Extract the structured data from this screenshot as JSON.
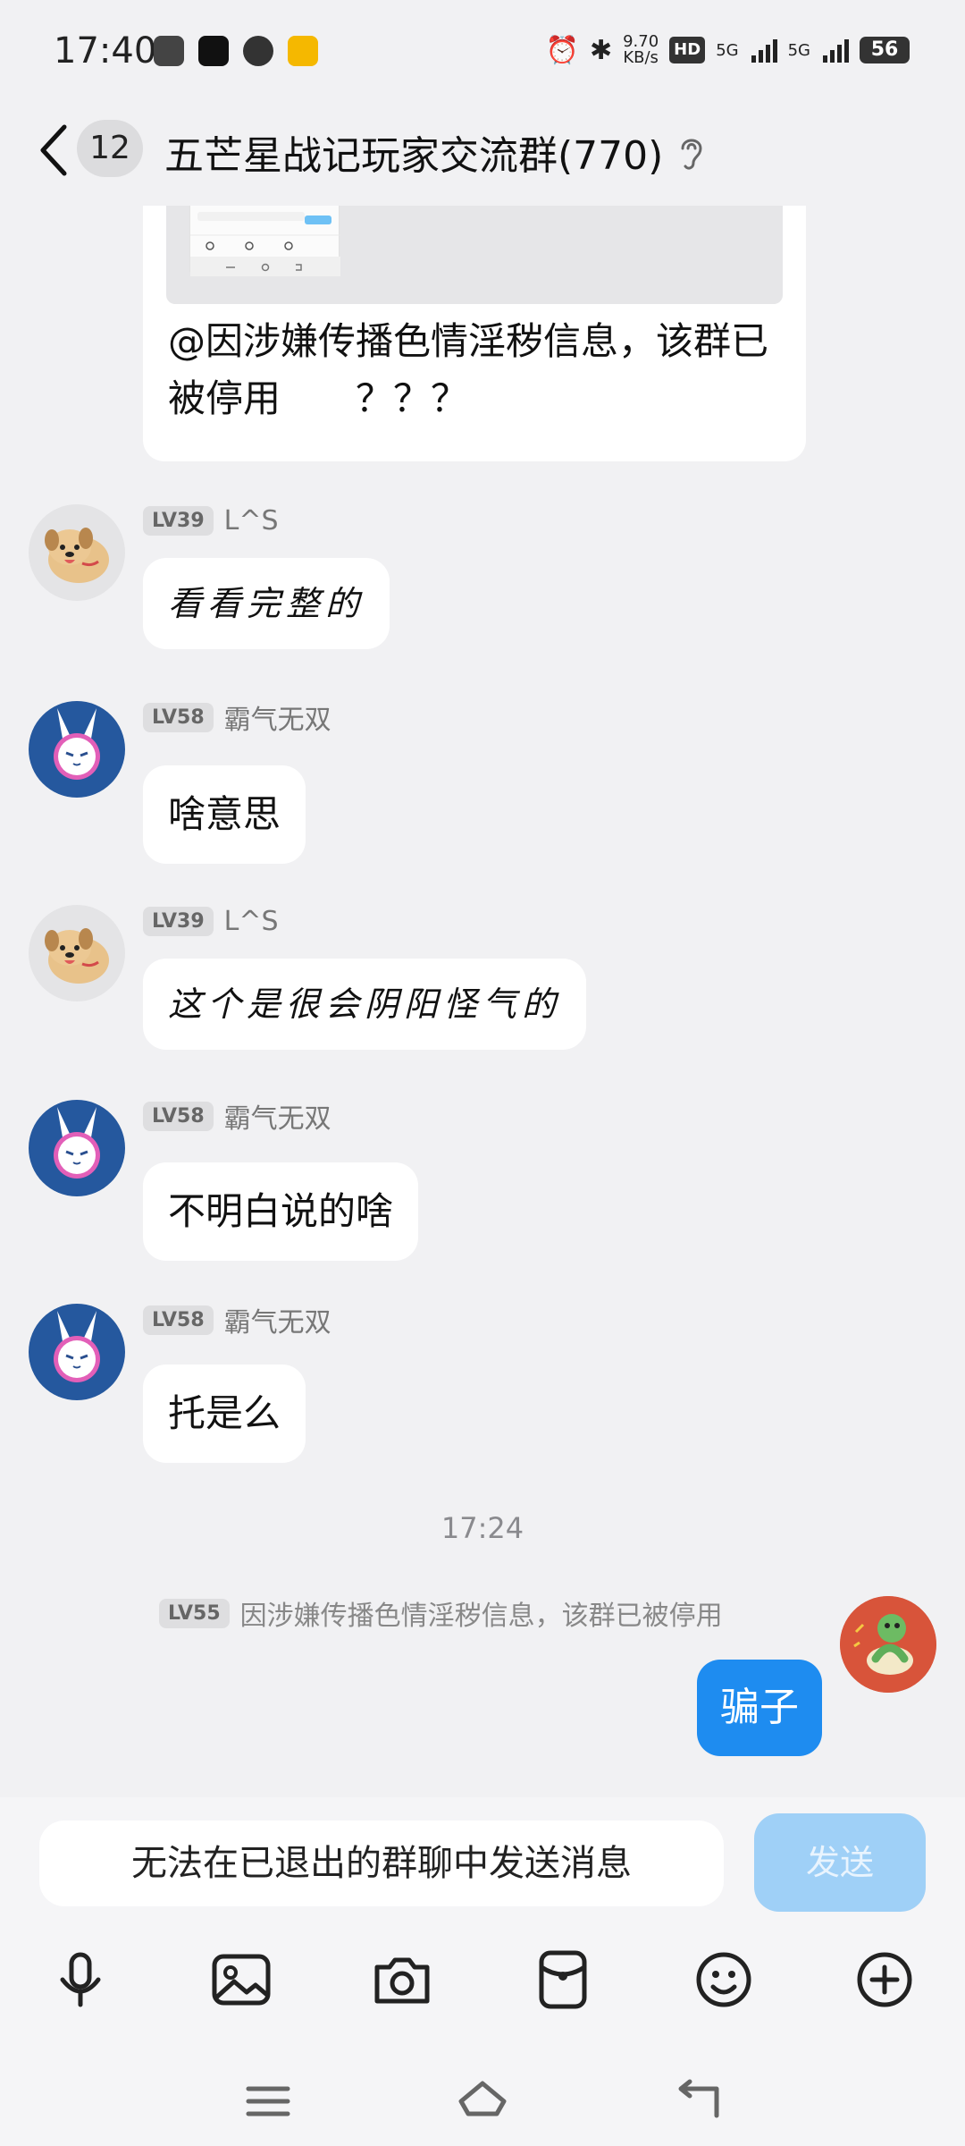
{
  "status_bar": {
    "time": "17:40",
    "net_speed_value": "9.70",
    "net_speed_unit": "KB/s",
    "sim1_label": "HD",
    "sim_sub": "1 2",
    "signal1_label": "5G",
    "signal2_label": "5G",
    "battery": "56"
  },
  "header": {
    "unread_count": "12",
    "title": "五芒星战记玩家交流群(770)"
  },
  "shared_card": {
    "text": "@因涉嫌传播色情淫秽信息，该群已被停用　　？？？"
  },
  "messages": [
    {
      "level": "LV39",
      "nick": "L^S",
      "text": "看看完整的"
    },
    {
      "level": "LV58",
      "nick": "霸气无双",
      "text": "啥意思"
    },
    {
      "level": "LV39",
      "nick": "L^S",
      "text": "这个是很会阴阳怪气的"
    },
    {
      "level": "LV58",
      "nick": "霸气无双",
      "text": "不明白说的啥"
    },
    {
      "level": "LV58",
      "nick": "霸气无双",
      "text": "托是么"
    }
  ],
  "time_divider": "17:24",
  "system_notice": {
    "level": "LV55",
    "text": "因涉嫌传播色情淫秽信息，该群已被停用"
  },
  "self_message": {
    "text": "骗子"
  },
  "input": {
    "placeholder": "无法在已退出的群聊中发送消息",
    "send_label": "发送"
  },
  "colors": {
    "self_bubble": "#1e8cf0",
    "send_disabled": "#9fd0f7",
    "background": "#f1f1f3"
  }
}
